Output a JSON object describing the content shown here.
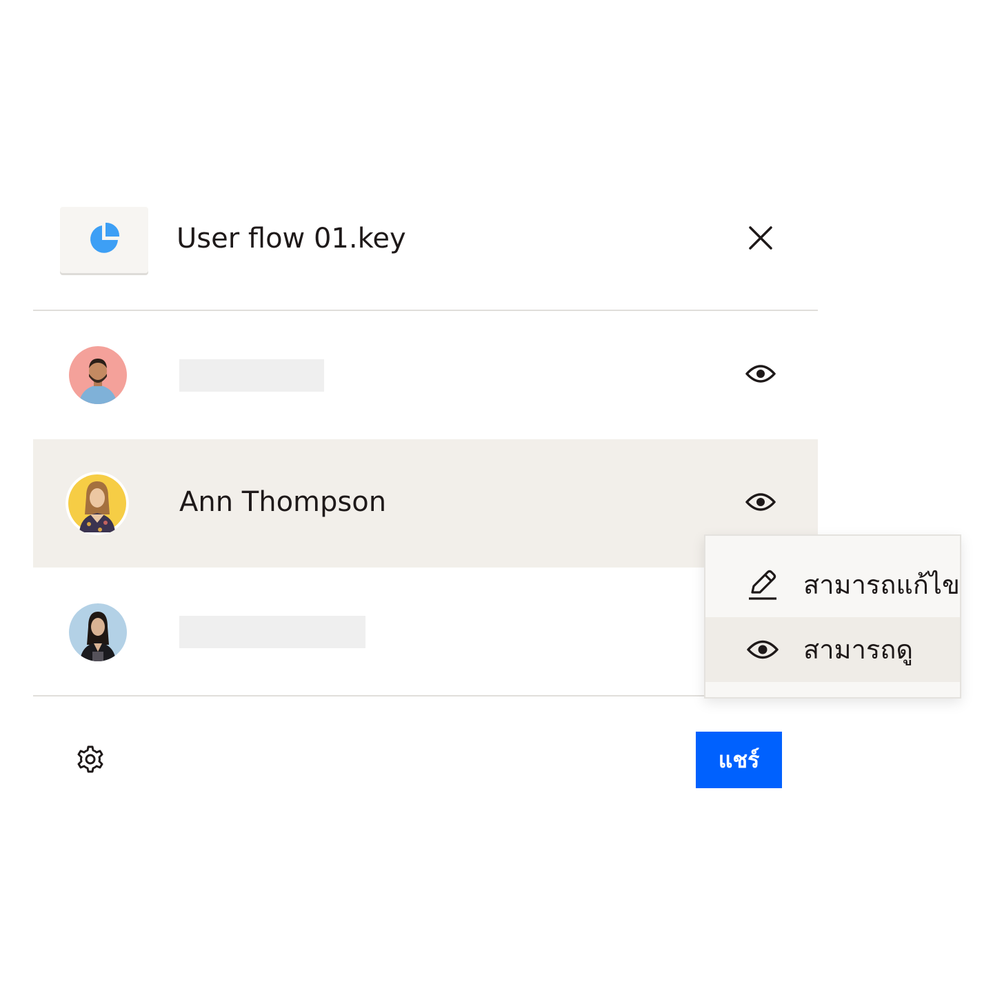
{
  "file": {
    "name": "User flow 01.key",
    "icon": "pie-chart-icon",
    "icon_color": "#3d9ff5"
  },
  "header": {
    "close_icon": "close-icon"
  },
  "members": [
    {
      "avatar_bg": "#f4a19a",
      "name": "",
      "permission_icon": "eye-icon"
    },
    {
      "avatar_bg": "#f6cd45",
      "name": "Ann Thompson",
      "permission_icon": "eye-icon"
    },
    {
      "avatar_bg": "#b3d1e6",
      "name": ""
    }
  ],
  "permission_menu": {
    "items": [
      {
        "icon": "pencil-icon",
        "label": "สามารถแก้ไข"
      },
      {
        "icon": "eye-icon",
        "label": "สามารถดู",
        "selected": true
      }
    ]
  },
  "footer": {
    "settings_icon": "gear-icon",
    "share_label": "แชร์",
    "share_color": "#0061fe"
  }
}
